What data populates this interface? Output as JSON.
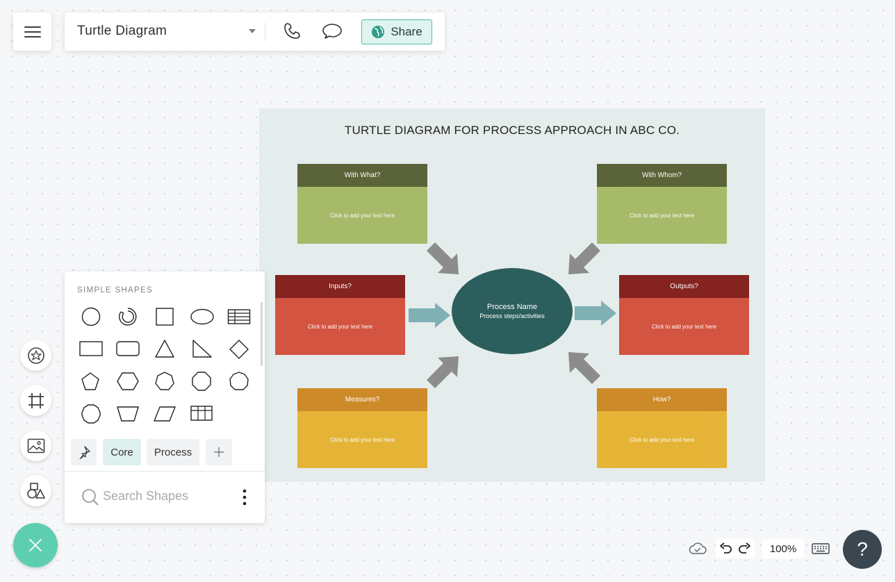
{
  "app": {
    "document_title": "Turtle Diagram",
    "share_label": "Share"
  },
  "diagram": {
    "title": "TURTLE DIAGRAM FOR PROCESS APPROACH IN ABC CO.",
    "center": {
      "title": "Process Name",
      "subtitle": "Process steps/activities"
    },
    "boxes": {
      "with_what": {
        "header": "With What?",
        "body": "Click to add your text here"
      },
      "with_whom": {
        "header": "With Whom?",
        "body": "Click to add your text here"
      },
      "inputs": {
        "header": "Inputs?",
        "body": "Click to add your text here"
      },
      "outputs": {
        "header": "Outputs?",
        "body": "Click to add your text here"
      },
      "measures": {
        "header": "Measures?",
        "body": "Click to add your text here"
      },
      "how": {
        "header": "How?",
        "body": "Click to add your text here"
      }
    },
    "colors": {
      "background": "#e5ecec",
      "green_header": "#5b6339",
      "green_body": "#a3b862",
      "red_header": "#842320",
      "red_body": "#d24c38",
      "yellow_header": "#cd8a28",
      "yellow_body": "#e6b22e",
      "ellipse": "#2b5e5d",
      "arrow_gray": "#8c8c8c",
      "arrow_teal": "#7fb0b4"
    }
  },
  "shapes_panel": {
    "header": "SIMPLE SHAPES",
    "shapes": [
      "circle",
      "arc",
      "square",
      "ellipse",
      "table",
      "rectangle",
      "rounded-rectangle",
      "triangle",
      "right-triangle",
      "diamond",
      "pentagon",
      "hexagon",
      "heptagon",
      "octagon",
      "nonagon",
      "decagon",
      "trapezoid",
      "parallelogram",
      "grid"
    ],
    "tabs": {
      "core": "Core",
      "process": "Process"
    },
    "search_placeholder": "Search Shapes"
  },
  "footer": {
    "zoom": "100%",
    "help": "?"
  },
  "accent_color": "#5dcfb0"
}
